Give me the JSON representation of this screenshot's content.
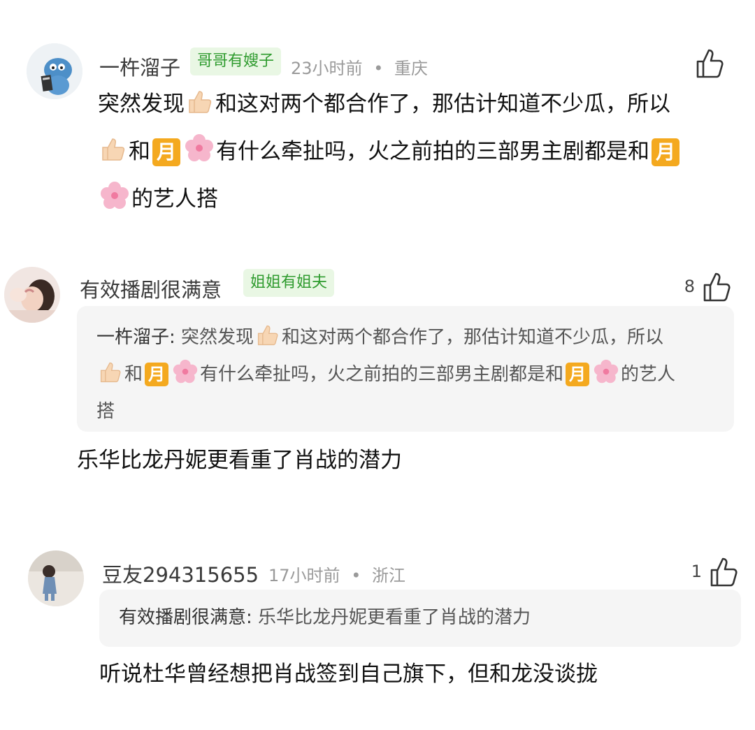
{
  "comments": [
    {
      "user": "一杵溜子",
      "badge": "哥哥有嫂子",
      "time": "23小时前",
      "location": "重庆",
      "likes": "",
      "body": {
        "p1": "突然发现",
        "p2": "和这对两个都合作了，那估计知道不少瓜，所以",
        "p3": "和",
        "p4": "有什么牵扯吗，火之前拍的三部男主剧都是和",
        "p5": "的艺人搭",
        "moon": "月"
      }
    },
    {
      "user": "有效播剧很满意",
      "badge": "姐姐有姐夫",
      "likes": "8",
      "quote": {
        "author": "一杵溜子:",
        "p1": "突然发现",
        "p2": "和这对两个都合作了，那估计知道不少瓜，所以",
        "p3": "和",
        "p4": "有什么牵扯吗，火之前拍的三部男主剧都是和",
        "p5": "的艺人",
        "p6": "搭",
        "moon": "月"
      },
      "body": "乐华比龙丹妮更看重了肖战的潜力"
    },
    {
      "user": "豆友294315655",
      "time": "17小时前",
      "location": "浙江",
      "likes": "1",
      "quote": {
        "author": "有效播剧很满意:",
        "text": "乐华比龙丹妮更看重了肖战的潜力"
      },
      "body": "听说杜华曾经想把肖战签到自己旗下，但和龙没谈拢"
    }
  ],
  "separator": "•",
  "colors": {
    "badge_bg": "#e9f7e4",
    "badge_text": "#2e9b2e",
    "moon": "#f4a91f"
  },
  "icons": [
    "thumbs-up-icon",
    "thumbs-up-emoji-icon",
    "sakura-flower-icon",
    "moon-emoji-icon"
  ]
}
